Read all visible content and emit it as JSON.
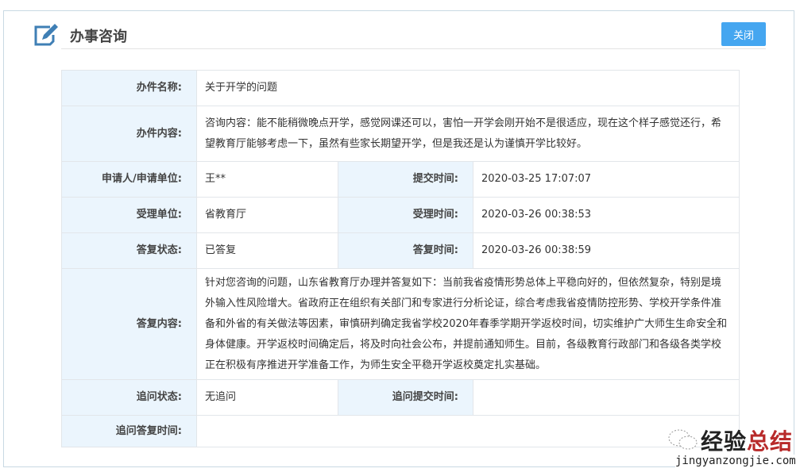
{
  "header": {
    "title": "办事咨询",
    "close_label": "关闭"
  },
  "rows": {
    "name_label": "办件名称:",
    "name_value": "关于开学的问题",
    "content_label": "办件内容:",
    "content_value": "咨询内容：能不能稍微晚点开学，感觉网课还可以，害怕一开学会刚开始不是很适应，现在这个样子感觉还行，希望教育厅能够考虑一下，虽然有些家长期望开学，但是我还是认为谨慎开学比较好。",
    "applicant_label": "申请人/申请单位:",
    "applicant_value": "王**",
    "submit_time_label": "提交时间:",
    "submit_time_value": "2020-03-25 17:07:07",
    "dept_label": "受理单位:",
    "dept_value": "省教育厅",
    "accept_time_label": "受理时间:",
    "accept_time_value": "2020-03-26 00:38:53",
    "status_label": "答复状态:",
    "status_value": "已答复",
    "reply_time_label": "答复时间:",
    "reply_time_value": "2020-03-26 00:38:59",
    "reply_label": "答复内容:",
    "reply_value": "针对您咨询的问题，山东省教育厅办理并答复如下：当前我省疫情形势总体上平稳向好的，但依然复杂，特别是境外输入性风险增大。省政府正在组织有关部门和专家进行分析论证，综合考虑我省疫情防控形势、学校开学条件准备和外省的有关做法等因素，审慎研判确定我省学校2020年春季学期开学返校时间，切实维护广大师生生命安全和身体健康。开学返校时间确定后，将及时向社会公布，并提前通知师生。目前，各级教育行政部门和各级各类学校正在积极有序推进开学准备工作，为师生安全平稳开学返校奠定扎实基础。",
    "followup_status_label": "追问状态:",
    "followup_status_value": "无追问",
    "followup_submit_label": "追问提交时间:",
    "followup_submit_value": "",
    "followup_reply_label": "追问答复时间:",
    "followup_reply_value": ""
  },
  "watermark": {
    "cn_a": "经验",
    "cn_b": "总结",
    "en": "jingyanzongjie.com"
  },
  "colors": {
    "accent": "#45a6f0",
    "label_bg": "#ebf5fd"
  }
}
